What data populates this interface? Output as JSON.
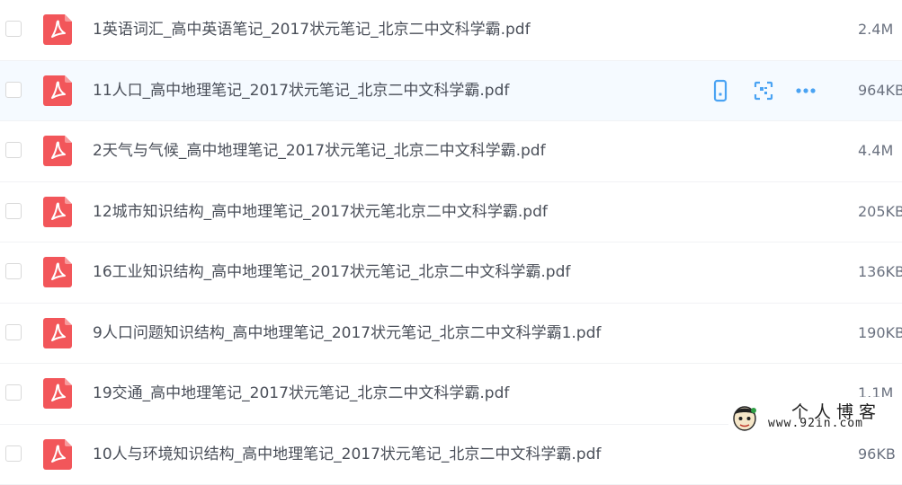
{
  "files": [
    {
      "name": "1英语词汇_高中英语笔记_2017状元笔记_北京二中文科学霸.pdf",
      "size": "2.4M"
    },
    {
      "name": "11人口_高中地理笔记_2017状元笔记_北京二中文科学霸.pdf",
      "size": "964KB"
    },
    {
      "name": "2天气与气候_高中地理笔记_2017状元笔记_北京二中文科学霸.pdf",
      "size": "4.4M"
    },
    {
      "name": "12城市知识结构_高中地理笔记_2017状元笔北京二中文科学霸.pdf",
      "size": "205KB"
    },
    {
      "name": "16工业知识结构_高中地理笔记_2017状元笔记_北京二中文科学霸.pdf",
      "size": "136KB"
    },
    {
      "name": "9人口问题知识结构_高中地理笔记_2017状元笔记_北京二中文科学霸1.pdf",
      "size": "190KB"
    },
    {
      "name": "19交通_高中地理笔记_2017状元笔记_北京二中文科学霸.pdf",
      "size": "1.1M"
    },
    {
      "name": "10人与环境知识结构_高中地理笔记_2017状元笔记_北京二中文科学霸.pdf",
      "size": "96KB"
    }
  ],
  "hover_row_index": 1,
  "row_actions": {
    "icons": [
      "phone-icon",
      "scan-icon",
      "more-icon"
    ],
    "color": "#4aa3f3"
  },
  "colors": {
    "pdf_icon": "#f2565a",
    "hover_bg": "#f5faff",
    "text": "#4a4f59"
  },
  "watermark": {
    "line1": "个人博客",
    "line2": "www.92in.com"
  }
}
